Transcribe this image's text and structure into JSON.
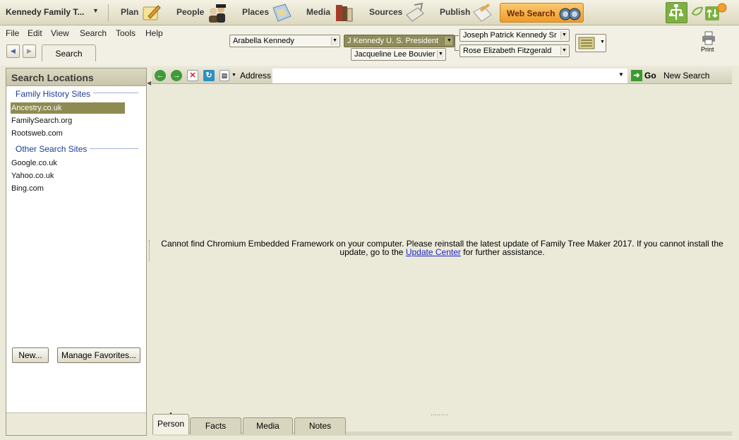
{
  "toolbar": {
    "tree_title": "Kennedy Family T...",
    "nav": [
      {
        "label": "Plan",
        "icon": "plan-icon"
      },
      {
        "label": "People",
        "icon": "people-icon"
      },
      {
        "label": "Places",
        "icon": "places-icon"
      },
      {
        "label": "Media",
        "icon": "media-icon"
      },
      {
        "label": "Sources",
        "icon": "sources-icon"
      },
      {
        "label": "Publish",
        "icon": "publish-icon"
      }
    ],
    "web_search": "Web Search",
    "accent": "#f09b2a"
  },
  "menu": [
    "File",
    "Edit",
    "View",
    "Search",
    "Tools",
    "Help"
  ],
  "tab": {
    "search": "Search"
  },
  "pedigree": {
    "spouse": "Arabella Kennedy",
    "selected": "J Kennedy U. S. President",
    "spouse2": "Jacqueline Lee Bouvier",
    "father": "Joseph Patrick Kennedy Sr",
    "mother": "Rose Elizabeth Fitzgerald"
  },
  "print": "Print",
  "left_panel": {
    "title": "Search Locations",
    "groups": [
      {
        "label": "Family History Sites",
        "sites": [
          "Ancestry.co.uk",
          "FamilySearch.org",
          "Rootsweb.com"
        ],
        "selected": "Ancestry.co.uk"
      },
      {
        "label": "Other Search Sites",
        "sites": [
          "Google.co.uk",
          "Yahoo.co.uk",
          "Bing.com"
        ]
      }
    ],
    "new_button": "New...",
    "manage_button": "Manage Favorites..."
  },
  "browser": {
    "address_label": "Address",
    "address_value": "",
    "go": "Go",
    "new_search": "New Search"
  },
  "message": {
    "before": "Cannot find Chromium Embedded Framework on your computer. Please reinstall the latest update of Family Tree Maker 2017. If you cannot install the update, go to the ",
    "link": "Update Center",
    "after": " for further assistance."
  },
  "bottom_tabs": [
    "Person",
    "Facts",
    "Media",
    "Notes"
  ]
}
